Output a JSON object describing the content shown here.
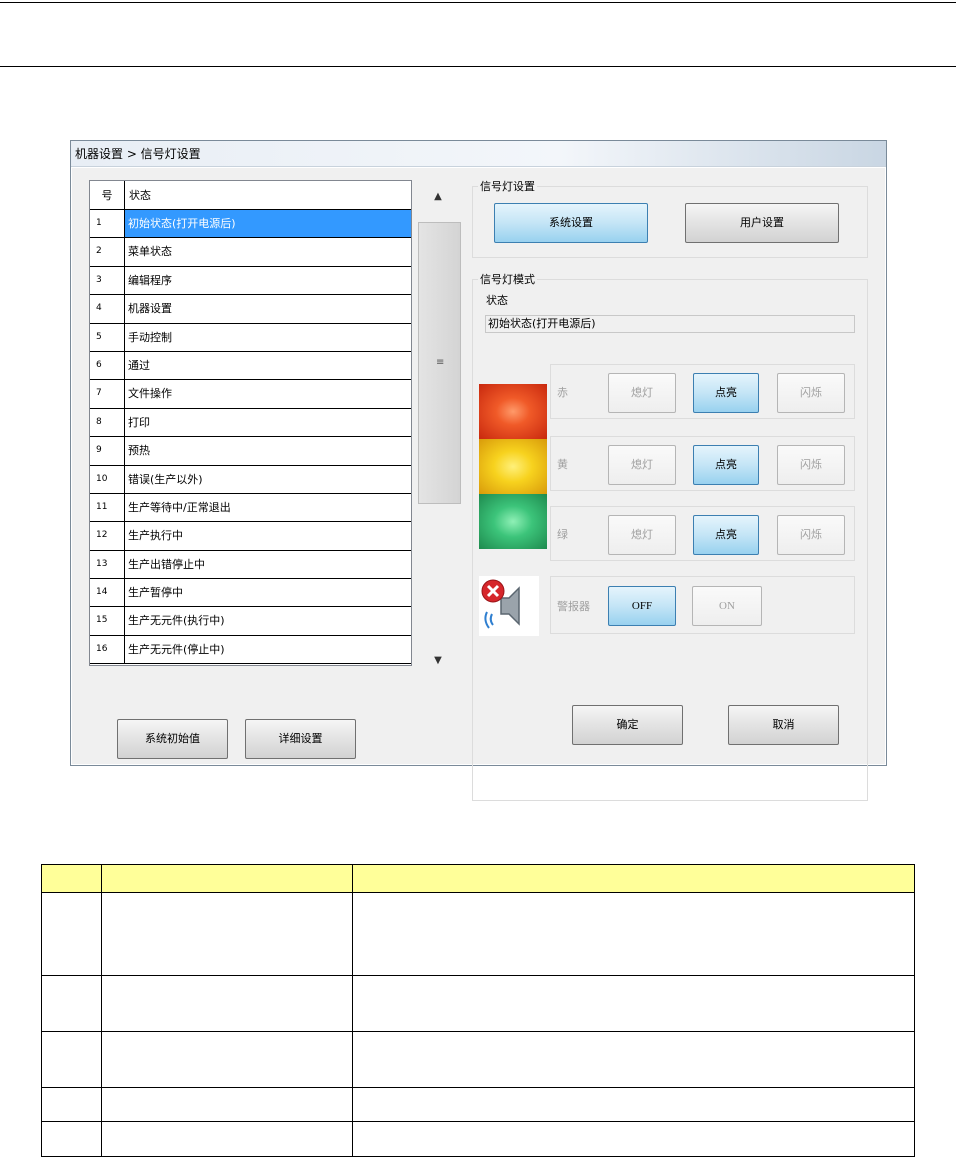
{
  "window": {
    "breadcrumb": "机器设置 > 信号灯设置"
  },
  "list": {
    "header_no": "号",
    "header_state": "状态",
    "selected_index": 0,
    "rows": [
      {
        "no": "1",
        "state": "初始状态(打开电源后)"
      },
      {
        "no": "2",
        "state": "菜单状态"
      },
      {
        "no": "3",
        "state": "编辑程序"
      },
      {
        "no": "4",
        "state": "机器设置"
      },
      {
        "no": "5",
        "state": "手动控制"
      },
      {
        "no": "6",
        "state": "通过"
      },
      {
        "no": "7",
        "state": "文件操作"
      },
      {
        "no": "8",
        "state": "打印"
      },
      {
        "no": "9",
        "state": "预热"
      },
      {
        "no": "10",
        "state": "错误(生产以外)"
      },
      {
        "no": "11",
        "state": "生产等待中/正常退出"
      },
      {
        "no": "12",
        "state": "生产执行中"
      },
      {
        "no": "13",
        "state": "生产出错停止中"
      },
      {
        "no": "14",
        "state": "生产暂停中"
      },
      {
        "no": "15",
        "state": "生产无元件(执行中)"
      },
      {
        "no": "16",
        "state": "生产无元件(停止中)"
      }
    ],
    "scroll_up": "▲",
    "scroll_down": "▼",
    "scroll_grip": "≡"
  },
  "signal_settings": {
    "group_title": "信号灯设置",
    "system_button": "系统设置",
    "user_button": "用户设置"
  },
  "signal_mode": {
    "group_title": "信号灯模式",
    "status_label": "状态",
    "status_value": "初始状态(打开电源后)",
    "lights": [
      {
        "label": "赤",
        "off": "熄灯",
        "on": "点亮",
        "blink": "闪烁",
        "selected": "on",
        "color": "#e8361b"
      },
      {
        "label": "黄",
        "off": "熄灯",
        "on": "点亮",
        "blink": "闪烁",
        "selected": "on",
        "color": "#f2c81a"
      },
      {
        "label": "绿",
        "off": "熄灯",
        "on": "点亮",
        "blink": "闪烁",
        "selected": "on",
        "color": "#2fb36a"
      }
    ],
    "buzzer": {
      "label": "警报器",
      "off": "OFF",
      "on": "ON",
      "selected": "off",
      "icon": "speaker-muted-icon"
    }
  },
  "bottom_buttons": {
    "system_default": "系统初始值",
    "detail_settings": "详细设置",
    "ok": "确定",
    "cancel": "取消"
  },
  "colors": {
    "selection": "#3399ff",
    "table_header": "#ffff99"
  }
}
